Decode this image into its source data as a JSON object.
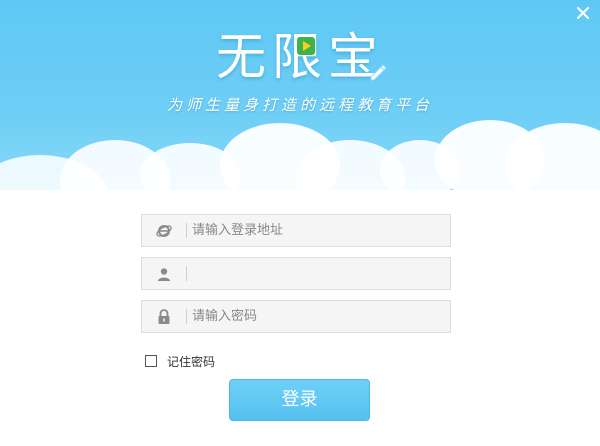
{
  "window": {
    "close_symbol": "✕"
  },
  "brand": {
    "logo_text": "无限宝",
    "slogan": "为师生量身打造的远程教育平台"
  },
  "form": {
    "address_placeholder": "请输入登录地址",
    "username_value": "",
    "password_placeholder": "请输入密码",
    "remember_label": "记住密码",
    "login_label": "登录"
  },
  "icons": {
    "address": "ie-browser-icon",
    "user": "user-icon",
    "password": "lock-icon",
    "close": "close-icon"
  },
  "colors": {
    "sky": "#5ec8f4",
    "button": "#5ec4f0"
  }
}
